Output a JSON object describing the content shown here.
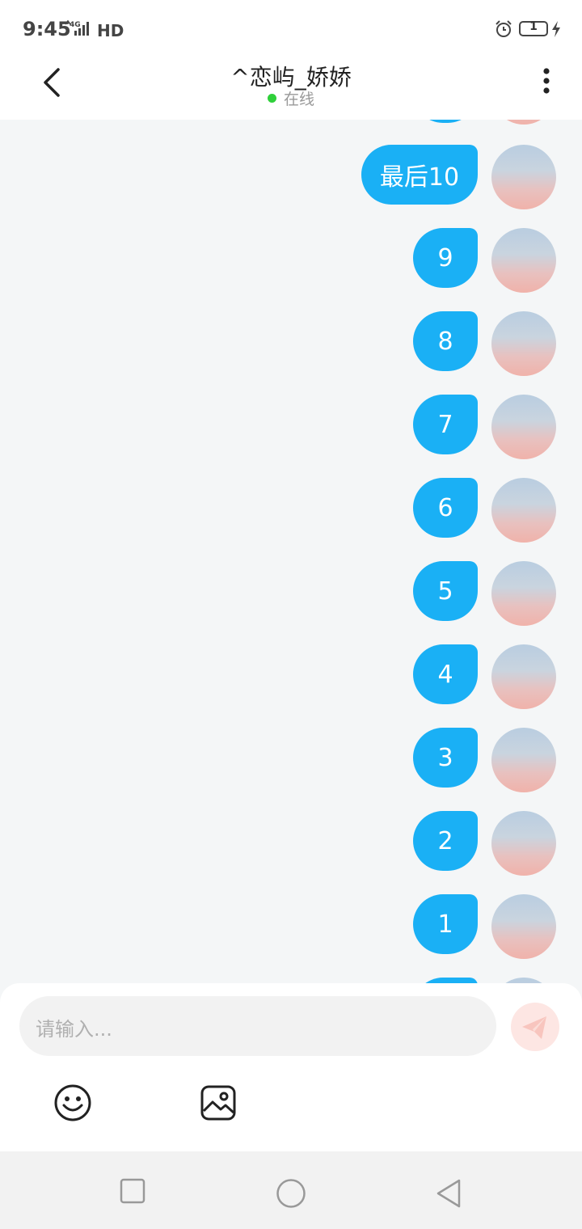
{
  "status_bar": {
    "time": "9:45",
    "network": "4G",
    "hd": "HD",
    "battery": "1",
    "icons": [
      "signal-icon",
      "alarm-icon",
      "battery-icon",
      "charging-icon"
    ]
  },
  "header": {
    "title": "^恋屿_娇娇",
    "status": "在线",
    "status_color": "#2fd03a",
    "back_icon": "chevron-left-icon",
    "more_icon": "more-vertical-icon"
  },
  "messages": [
    {
      "text": "最后10"
    },
    {
      "text": "9"
    },
    {
      "text": "8"
    },
    {
      "text": "7"
    },
    {
      "text": "6"
    },
    {
      "text": "5"
    },
    {
      "text": "4"
    },
    {
      "text": "3"
    },
    {
      "text": "2"
    },
    {
      "text": "1"
    }
  ],
  "bubble_color": "#1ab0f5",
  "input": {
    "placeholder": "请输入...",
    "send_icon": "paper-plane-icon"
  },
  "toolbar": {
    "emoji_icon": "smiley-icon",
    "image_icon": "image-icon"
  },
  "nav_bar": {
    "icons": [
      "recent-apps-icon",
      "home-icon",
      "back-icon"
    ]
  }
}
